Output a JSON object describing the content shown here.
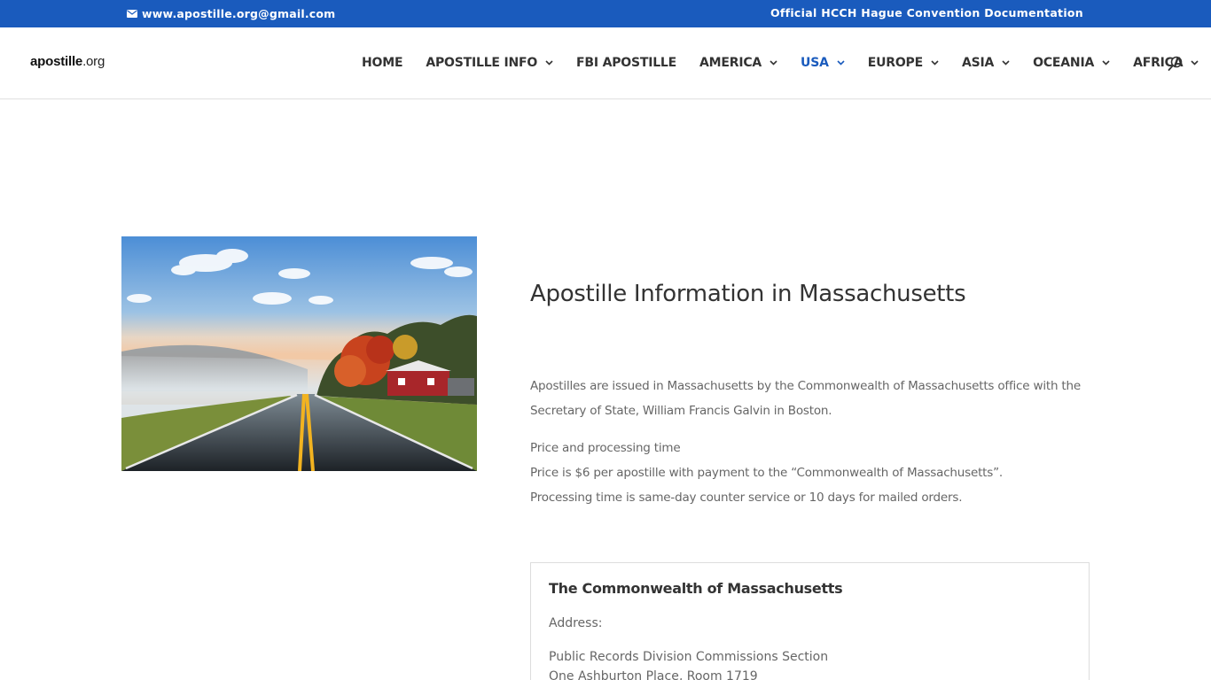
{
  "topbar": {
    "email": "www.apostille.org@gmail.com",
    "right_link": "Official HCCH Hague Convention Documentation"
  },
  "header": {
    "logo_main": "apostille",
    "logo_tld": ".org",
    "nav": [
      {
        "label": "HOME",
        "has_dropdown": false,
        "active": false
      },
      {
        "label": "APOSTILLE INFO",
        "has_dropdown": true,
        "active": false
      },
      {
        "label": "FBI APOSTILLE",
        "has_dropdown": false,
        "active": false
      },
      {
        "label": "AMERICA",
        "has_dropdown": true,
        "active": false
      },
      {
        "label": "USA",
        "has_dropdown": true,
        "active": true
      },
      {
        "label": "EUROPE",
        "has_dropdown": true,
        "active": false
      },
      {
        "label": "ASIA",
        "has_dropdown": true,
        "active": false
      },
      {
        "label": "OCEANIA",
        "has_dropdown": true,
        "active": false
      },
      {
        "label": "AFRICA",
        "has_dropdown": true,
        "active": false
      }
    ]
  },
  "main": {
    "title": "Apostille Information in Massachusetts",
    "intro": "Apostilles are issued in Massachusetts by the Commonwealth of Massachusetts office with the Secretary of State, William Francis Galvin in Boston.",
    "pricing": {
      "heading": "Price and processing time",
      "price": "Price is $6 per apostille with payment to the “Commonwealth of Massachusetts”.",
      "processing": "Processing time is same-day counter service or 10 days for mailed orders."
    }
  },
  "office": {
    "title": "The Commonwealth of Massachusetts",
    "address_label": "Address:",
    "address_lines": [
      "Public Records Division Commissions Section",
      "One Ashburton Place, Room 1719"
    ]
  },
  "colors": {
    "brand_blue": "#1a5bbd",
    "nav_text": "#333333",
    "body_text": "#666666"
  }
}
